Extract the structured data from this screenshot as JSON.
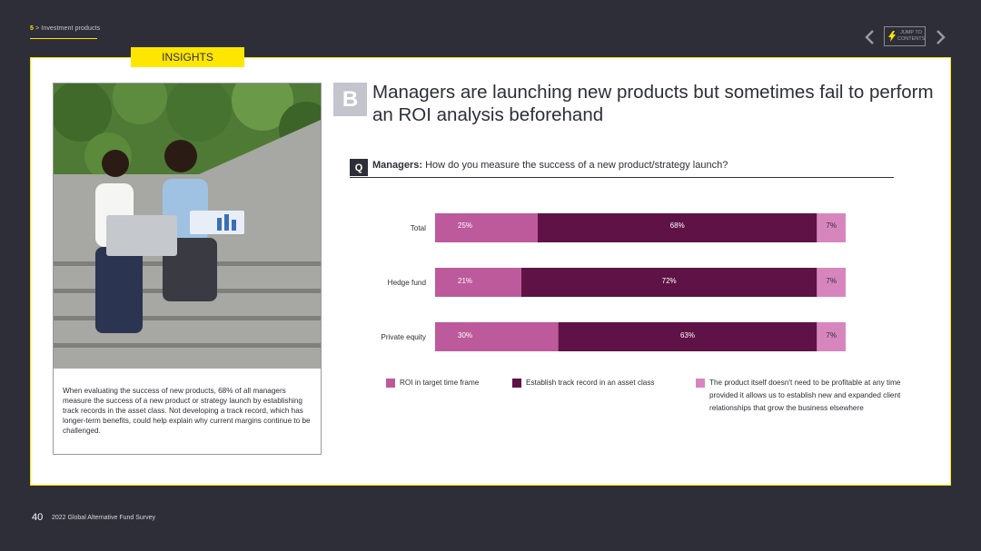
{
  "header": {
    "section_number": "5",
    "section_title": "Investment products",
    "jump_line1": "JUMP TO",
    "jump_line2": "CONTENTS"
  },
  "insights_tag": "INSIGHTS",
  "caption": "When evaluating the success of new products, 68% of all managers measure the success of a new product or strategy launch by establishing track records in the asset class. Not developing a track record, which has longer-term benefits, could help explain why current margins continue to be challenged.",
  "badge_letter": "B",
  "headline": "Managers are launching new products but sometimes fail to perform an ROI analysis beforehand",
  "question": {
    "badge": "Q",
    "lead": "Managers:",
    "text": "How do you measure the success of a new product/strategy launch?"
  },
  "colors": {
    "roi": "#bd5a9b",
    "track": "#5f1246",
    "product": "#d786bd",
    "accent": "#ffe600",
    "background": "#2e2e38"
  },
  "chart_data": {
    "type": "bar",
    "orientation": "horizontal",
    "stacked": true,
    "categories": [
      "Total",
      "Hedge fund",
      "Private equity"
    ],
    "series": [
      {
        "name": "ROI in target time frame",
        "values": [
          25,
          21,
          30
        ],
        "labels": [
          "25%",
          "21%",
          "30%"
        ]
      },
      {
        "name": "Establish track record in an asset class",
        "values": [
          68,
          72,
          63
        ],
        "labels": [
          "68%",
          "72%",
          "63%"
        ]
      },
      {
        "name": "The product itself doesn't need to be profitable at any time provided it allows us to establish new and expanded client relationships that grow the business elsewhere",
        "values": [
          7,
          7,
          7
        ],
        "labels": [
          "7%",
          "7%",
          "7%"
        ]
      }
    ],
    "xlim": [
      0,
      100
    ],
    "grid": false,
    "legend_position": "bottom"
  },
  "footer": {
    "page_number": "40",
    "survey_title": "2022 Global Alternative Fund Survey"
  }
}
